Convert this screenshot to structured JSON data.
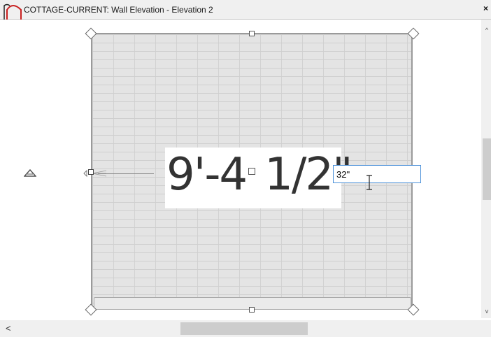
{
  "window": {
    "title": "COTTAGE-CURRENT: Wall Elevation - Elevation 2",
    "close_label": "×"
  },
  "drawing": {
    "dimension_text": "9'-4",
    "dimension_text_suffix": "1/2\"",
    "input_value": "32\""
  },
  "scrollbar": {
    "left_arrow": "<",
    "up_arrow": "^",
    "down_arrow": "v"
  }
}
